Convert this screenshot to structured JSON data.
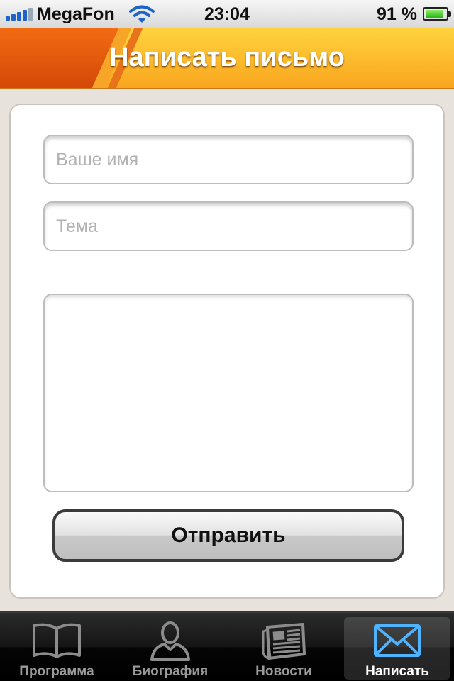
{
  "status_bar": {
    "carrier": "MegaFon",
    "time": "23:04",
    "battery": "91 %",
    "battery_level": 0.91
  },
  "header": {
    "title": "Написать письмо"
  },
  "form": {
    "name_placeholder": "Ваше имя",
    "subject_placeholder": "Тема",
    "message_value": "",
    "send_label": "Отправить"
  },
  "tab_bar": {
    "tabs": [
      {
        "label": "Программа",
        "icon": "book-icon",
        "active": false
      },
      {
        "label": "Биография",
        "icon": "person-icon",
        "active": false
      },
      {
        "label": "Новости",
        "icon": "newspaper-icon",
        "active": false
      },
      {
        "label": "Написать",
        "icon": "envelope-icon",
        "active": true
      }
    ]
  },
  "colors": {
    "header_orange": "#f9a51d",
    "header_dark": "#d44708",
    "active_icon_blue": "#4fb3ff"
  }
}
